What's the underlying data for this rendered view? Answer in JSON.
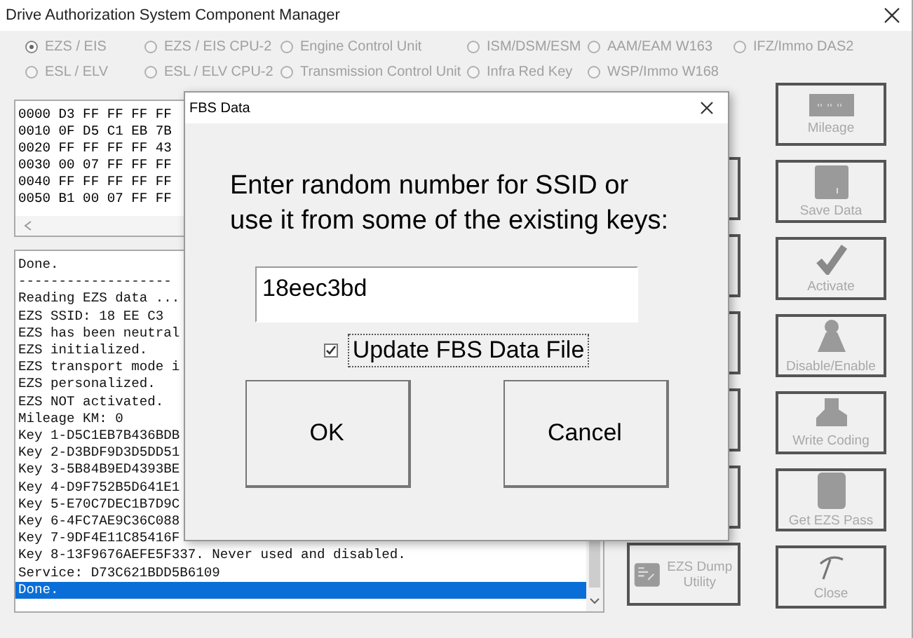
{
  "window": {
    "title": "Drive Authorization System Component Manager"
  },
  "radios": [
    {
      "label": "EZS / EIS",
      "selected": true,
      "disabled": true
    },
    {
      "label": "EZS / EIS CPU-2",
      "selected": false,
      "disabled": true
    },
    {
      "label": "Engine Control Unit",
      "selected": false,
      "disabled": true
    },
    {
      "label": "ISM/DSM/ESM",
      "selected": false,
      "disabled": true
    },
    {
      "label": "AAM/EAM W163",
      "selected": false,
      "disabled": true
    },
    {
      "label": "IFZ/Immo DAS2",
      "selected": false,
      "disabled": true
    },
    {
      "label": "ESL / ELV",
      "selected": false,
      "disabled": true
    },
    {
      "label": "ESL / ELV CPU-2",
      "selected": false,
      "disabled": true
    },
    {
      "label": "Transmission Control Unit",
      "selected": false,
      "disabled": true
    },
    {
      "label": "Infra Red Key",
      "selected": false,
      "disabled": true
    },
    {
      "label": "WSP/Immo W168",
      "selected": false,
      "disabled": true
    }
  ],
  "hex_dump": [
    "0000 D3 FF FF FF FF",
    "0010 0F D5 C1 EB 7B",
    "0020 FF FF FF FF 43",
    "0030 00 07 FF FF FF",
    "0040 FF FF FF FF FF",
    "0050 B1 00 07 FF FF"
  ],
  "log": [
    {
      "text": "Done.",
      "selected": false
    },
    {
      "text": "-------------------",
      "selected": false
    },
    {
      "text": "Reading EZS data ...",
      "selected": false
    },
    {
      "text": "EZS SSID: 18 EE C3",
      "selected": false
    },
    {
      "text": "EZS has been neutral",
      "selected": false
    },
    {
      "text": "EZS initialized.",
      "selected": false
    },
    {
      "text": "EZS transport mode i",
      "selected": false
    },
    {
      "text": "EZS personalized.",
      "selected": false
    },
    {
      "text": "EZS NOT activated.",
      "selected": false
    },
    {
      "text": "Mileage KM: 0",
      "selected": false
    },
    {
      "text": "Key 1-D5C1EB7B436BDB",
      "selected": false
    },
    {
      "text": "Key 2-D3BDF9D3D5DD51",
      "selected": false
    },
    {
      "text": "Key 3-5B84B9ED4393BE",
      "selected": false
    },
    {
      "text": "Key 4-D9F752B5D641E1",
      "selected": false
    },
    {
      "text": "Key 5-E70C7DEC1B7D9C",
      "selected": false
    },
    {
      "text": "Key 6-4FC7AE9C36C088",
      "selected": false
    },
    {
      "text": "Key 7-9DF4E11C85416F",
      "selected": false
    },
    {
      "text": "Key 8-13F9676AEFE5F337. Never used and disabled.",
      "selected": false
    },
    {
      "text": "Service: D73C621BDD5B6109",
      "selected": false
    },
    {
      "text": "Done.",
      "selected": true
    }
  ],
  "dump_button": {
    "label": "EZS Dump Utility",
    "disabled": true
  },
  "side_buttons": [
    {
      "kind": "mileage",
      "label": "Mileage",
      "disabled": true
    },
    {
      "kind": "save",
      "label": "Save Data",
      "disabled": true
    },
    {
      "kind": "activate",
      "label": "Activate",
      "disabled": true
    },
    {
      "kind": "disable",
      "label": "Disable/Enable",
      "disabled": true
    },
    {
      "kind": "coding",
      "label": "Write Coding",
      "disabled": true
    },
    {
      "kind": "pass",
      "label": "Get EZS Pass",
      "disabled": true
    },
    {
      "kind": "close",
      "label": "Close",
      "disabled": true
    }
  ],
  "dialog": {
    "title": "FBS Data",
    "prompt": "Enter random number for SSID or use it from some of the existing keys:",
    "input": {
      "value": "18eec3bd"
    },
    "checkbox": {
      "label": "Update FBS Data File",
      "checked": true
    },
    "buttons": [
      "OK",
      "Cancel"
    ]
  }
}
